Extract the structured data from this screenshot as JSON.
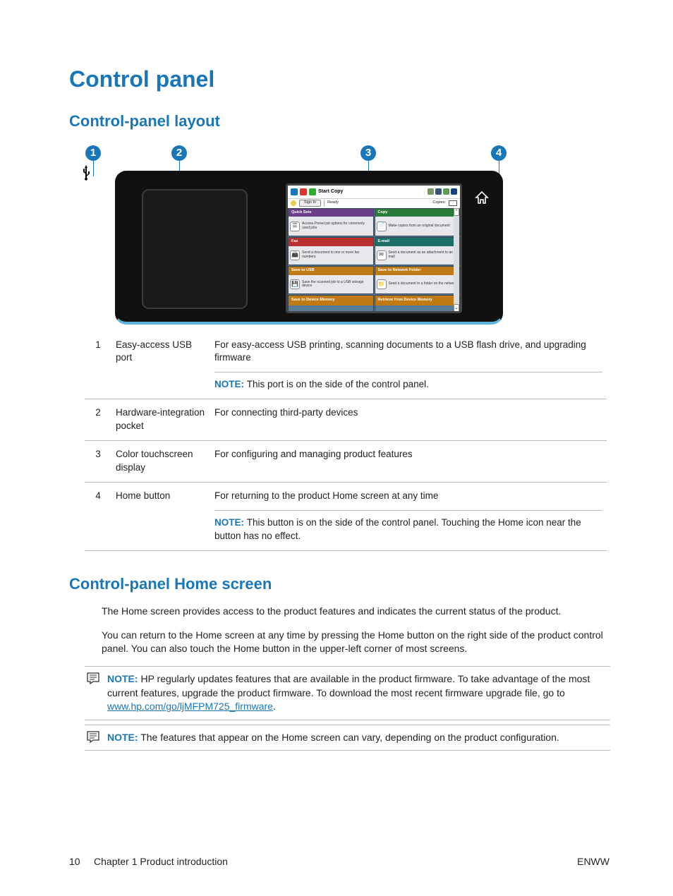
{
  "headings": {
    "h1": "Control panel",
    "h2a": "Control-panel layout",
    "h2b": "Control-panel Home screen"
  },
  "callout_numbers": [
    "1",
    "2",
    "3",
    "4"
  ],
  "screen": {
    "start_copy": "Start Copy",
    "sign_in": "Sign In",
    "ready": "Ready",
    "copies": "Copies:",
    "tiles": [
      {
        "title": "Quick Sets",
        "desc": "Access Preset job options for commonly used jobs",
        "head": "h-purple"
      },
      {
        "title": "Copy",
        "desc": "Make copies from an original document",
        "head": "h-green"
      },
      {
        "title": "Fax",
        "desc": "Send a document to one or more fax numbers",
        "head": "h-red"
      },
      {
        "title": "E-mail",
        "desc": "Send a document as an attachment to an e-mail",
        "head": "h-teal"
      },
      {
        "title": "Save to USB",
        "desc": "Save the scanned job to a USB storage device",
        "head": "h-amber"
      },
      {
        "title": "Save to Network Folder",
        "desc": "Send a document to a folder on the network",
        "head": "h-amber"
      },
      {
        "title": "Save to Device Memory",
        "desc": "",
        "head": "h-amber"
      },
      {
        "title": "Retrieve from Device Memory",
        "desc": "",
        "head": "h-amber"
      }
    ]
  },
  "table": [
    {
      "num": "1",
      "label": "Easy-access USB port",
      "desc": "For easy-access USB printing, scanning documents to a USB flash drive, and upgrading firmware",
      "note": "This port is on the side of the control panel."
    },
    {
      "num": "2",
      "label": "Hardware-integration pocket",
      "desc": "For connecting third-party devices",
      "note": ""
    },
    {
      "num": "3",
      "label": "Color touchscreen display",
      "desc": "For configuring and managing product features",
      "note": ""
    },
    {
      "num": "4",
      "label": "Home button",
      "desc": "For returning to the product Home screen at any time",
      "note": "This button is on the side of the control panel. Touching the Home icon near the button has no effect."
    }
  ],
  "note_label": "NOTE:",
  "paras": {
    "p1": "The Home screen provides access to the product features and indicates the current status of the product.",
    "p2": "You can return to the Home screen at any time by pressing the Home button on the right side of the product control panel. You can also touch the Home button in the upper-left corner of most screens."
  },
  "notes": {
    "n1_pre": "HP regularly updates features that are available in the product firmware. To take advantage of the most current features, upgrade the product firmware. To download the most recent firmware upgrade file, go to ",
    "n1_link": "www.hp.com/go/ljMFPM725_firmware",
    "n1_post": ".",
    "n2": "The features that appear on the Home screen can vary, depending on the product configuration."
  },
  "footer": {
    "page": "10",
    "chapter": "Chapter 1   Product introduction",
    "right": "ENWW"
  }
}
